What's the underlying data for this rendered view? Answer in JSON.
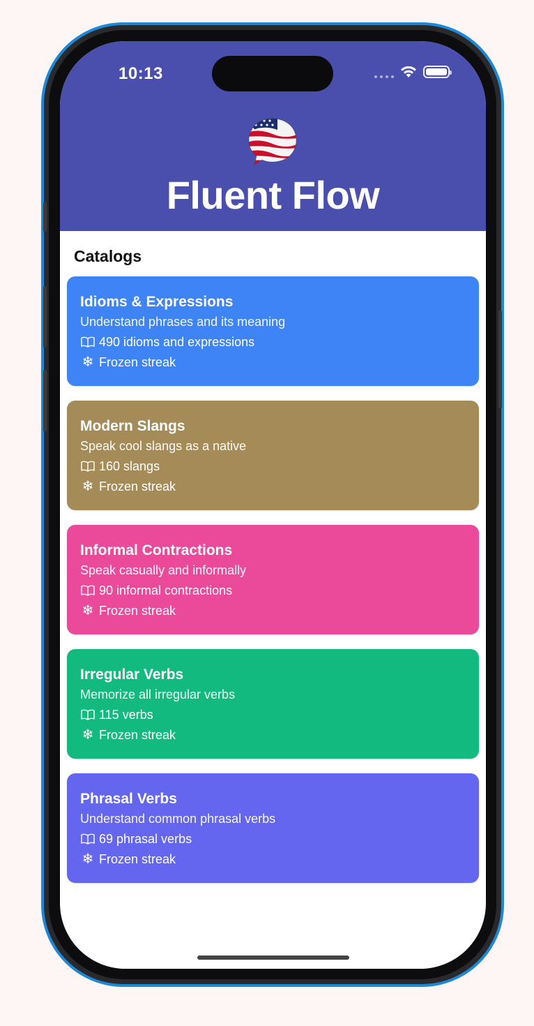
{
  "status_bar": {
    "time": "10:13",
    "wifi_icon": "wifi-icon",
    "battery_icon": "battery-icon",
    "battery_level": 1.0
  },
  "header": {
    "app_title": "Fluent Flow",
    "logo_icon": "us-flag-speech-bubble-icon",
    "background_color": "#4a4fad"
  },
  "catalogs": {
    "section_title": "Catalogs",
    "items": [
      {
        "title": "Idioms & Expressions",
        "subtitle": "Understand phrases and its meaning",
        "count_text": "490 idioms and expressions",
        "streak_text": "Frozen streak",
        "color": "#3f84f6"
      },
      {
        "title": "Modern Slangs",
        "subtitle": "Speak cool slangs as a native",
        "count_text": "160 slangs",
        "streak_text": "Frozen streak",
        "color": "#a48b58"
      },
      {
        "title": "Informal Contractions",
        "subtitle": "Speak casually and informally",
        "count_text": "90 informal contractions",
        "streak_text": "Frozen streak",
        "color": "#eb4a9b"
      },
      {
        "title": "Irregular Verbs",
        "subtitle": "Memorize all irregular verbs",
        "count_text": "115 verbs",
        "streak_text": "Frozen streak",
        "color": "#12ba80"
      },
      {
        "title": "Phrasal Verbs",
        "subtitle": "Understand common phrasal verbs",
        "count_text": "69 phrasal verbs",
        "streak_text": "Frozen streak",
        "color": "#6466f0"
      }
    ]
  },
  "icons": {
    "count_icon": "open-book-icon",
    "streak_icon": "snowflake-icon"
  }
}
